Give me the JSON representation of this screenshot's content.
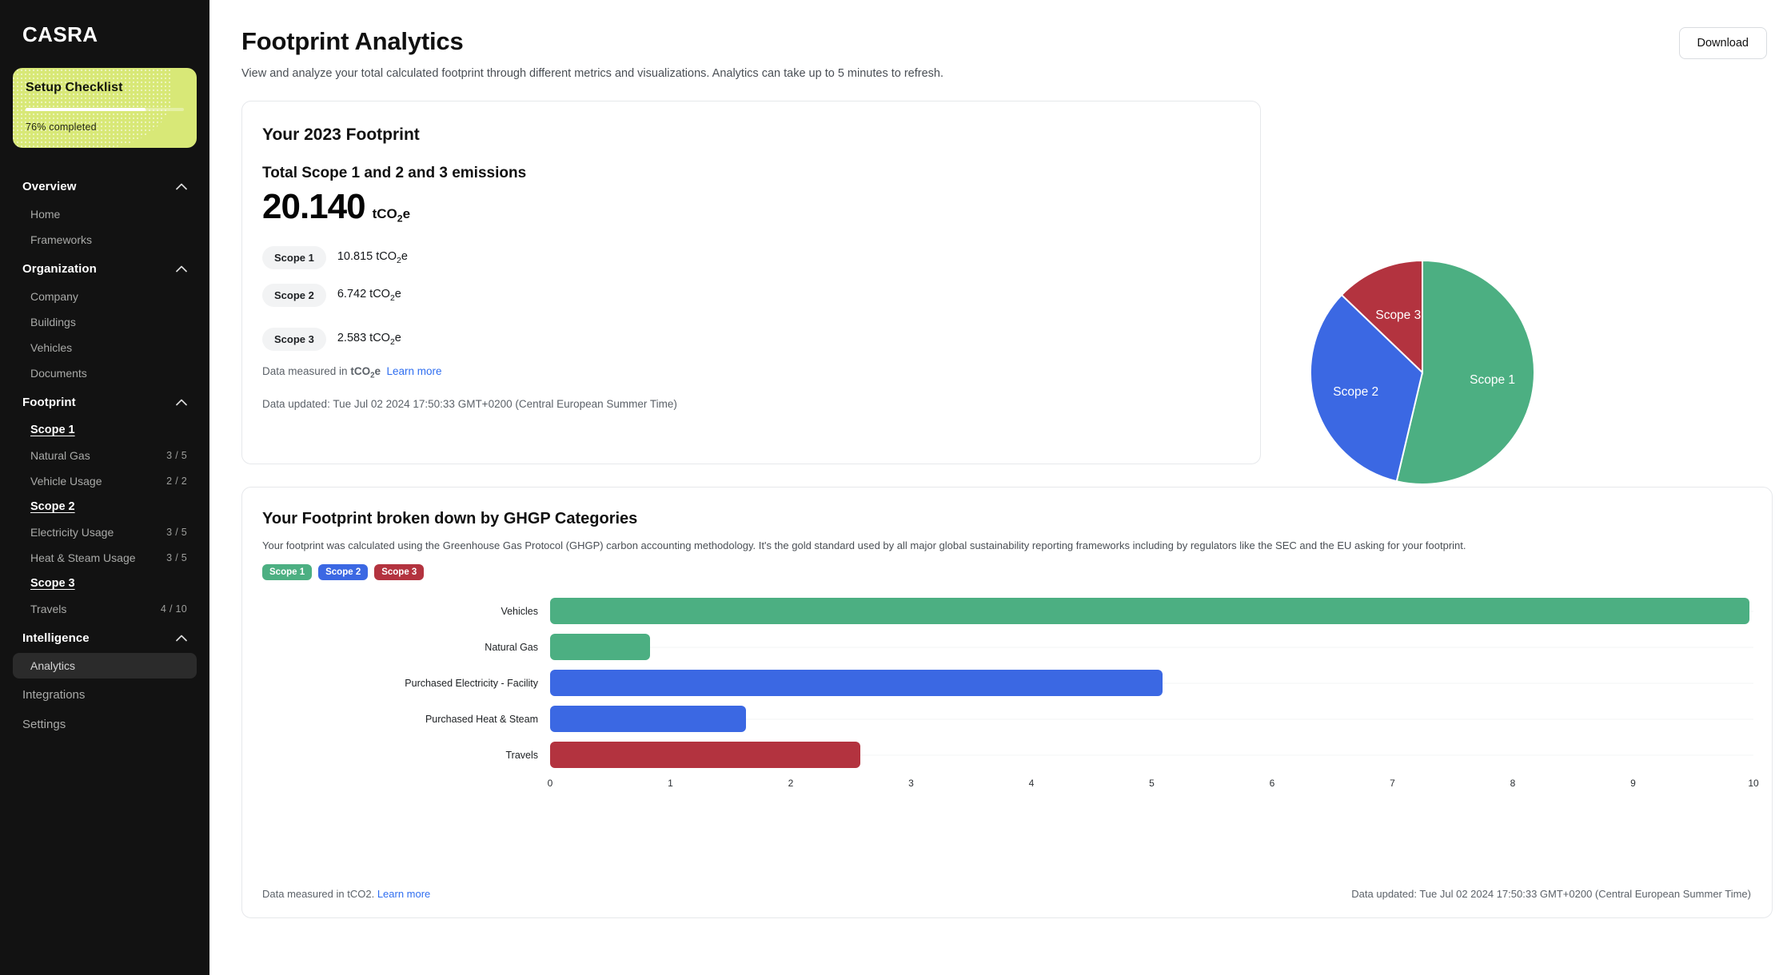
{
  "brand": "CASRA",
  "checklist": {
    "title": "Setup Checklist",
    "progress_label": "76% completed",
    "progress_percent": 76,
    "bg_color": "#d8e877"
  },
  "sidebar": {
    "groups": [
      {
        "label": "Overview",
        "expanded": true,
        "items": [
          {
            "label": "Home",
            "count": "",
            "kind": "item",
            "active": false
          },
          {
            "label": "Frameworks",
            "count": "",
            "kind": "item",
            "active": false
          }
        ]
      },
      {
        "label": "Organization",
        "expanded": true,
        "items": [
          {
            "label": "Company",
            "count": "",
            "kind": "item",
            "active": false
          },
          {
            "label": "Buildings",
            "count": "",
            "kind": "item",
            "active": false
          },
          {
            "label": "Vehicles",
            "count": "",
            "kind": "item",
            "active": false
          },
          {
            "label": "Documents",
            "count": "",
            "kind": "item",
            "active": false
          }
        ]
      },
      {
        "label": "Footprint",
        "expanded": true,
        "items": [
          {
            "label": "Scope 1",
            "count": "",
            "kind": "scope",
            "active": false
          },
          {
            "label": "Natural Gas",
            "count": "3 / 5",
            "kind": "item",
            "active": false
          },
          {
            "label": "Vehicle Usage",
            "count": "2 / 2",
            "kind": "item",
            "active": false
          },
          {
            "label": "Scope 2",
            "count": "",
            "kind": "scope",
            "active": false
          },
          {
            "label": "Electricity Usage",
            "count": "3 / 5",
            "kind": "item",
            "active": false
          },
          {
            "label": "Heat & Steam Usage",
            "count": "3 / 5",
            "kind": "item",
            "active": false
          },
          {
            "label": "Scope 3",
            "count": "",
            "kind": "scope",
            "active": false
          },
          {
            "label": "Travels",
            "count": "4 / 10",
            "kind": "item",
            "active": false
          }
        ]
      },
      {
        "label": "Intelligence",
        "expanded": true,
        "items": [
          {
            "label": "Analytics",
            "count": "",
            "kind": "item",
            "active": true
          }
        ]
      }
    ],
    "flat_items": [
      {
        "label": "Integrations"
      },
      {
        "label": "Settings"
      }
    ]
  },
  "header": {
    "title": "Footprint Analytics",
    "subtitle": "View and analyze your total calculated footprint through different metrics and visualizations. Analytics can take up to 5 minutes to refresh.",
    "download_label": "Download"
  },
  "footprint_card": {
    "title": "Your 2023 Footprint",
    "total_label": "Total Scope 1 and 2 and 3 emissions",
    "total_value": "20.140",
    "unit_prefix": "tCO",
    "unit_sub": "2",
    "unit_suffix": "e",
    "scopes": [
      {
        "pill": "Scope 1",
        "value": "10.815 tCO",
        "sub": "2",
        "value_suffix": "e"
      },
      {
        "pill": "Scope 2",
        "value": "6.742 tCO",
        "sub": "2",
        "value_suffix": "e"
      },
      {
        "pill": "Scope 3",
        "value": "2.583 tCO",
        "sub": "2",
        "value_suffix": "e"
      }
    ],
    "measured_prefix": "Data measured in",
    "measured_unit": "tCO",
    "measured_sub": "2",
    "measured_suffix": "e",
    "learn_more": "Learn more",
    "updated": "Data updated: Tue Jul 02 2024 17:50:33 GMT+0200 (Central European Summer Time)"
  },
  "breakdown_card": {
    "title": "Your Footprint broken down by GHGP Categories",
    "subtitle": "Your footprint was calculated using the Greenhouse Gas Protocol (GHGP) carbon accounting methodology. It's the gold standard used by all major global sustainability reporting frameworks including by regulators like the SEC and the EU asking for your footprint.",
    "footer_measured": "Data measured in tCO2.",
    "footer_learn_more": "Learn more",
    "footer_updated": "Data updated: Tue Jul 02 2024 17:50:33 GMT+0200 (Central European Summer Time)"
  },
  "colors": {
    "scope1": "#4caf82",
    "scope2": "#3b68e3",
    "scope3": "#b3333f",
    "accent_link": "#2f6ef0",
    "sidebar_bg": "#121212"
  },
  "chart_data": [
    {
      "type": "pie",
      "title": "",
      "labels": [
        "Scope 1",
        "Scope 2",
        "Scope 3"
      ],
      "values": [
        10.815,
        6.742,
        2.583
      ],
      "percentages": [
        53.7,
        33.5,
        12.8
      ],
      "colors": [
        "#4caf82",
        "#3b68e3",
        "#b3333f"
      ],
      "legend": "none",
      "labels_inside": true
    },
    {
      "type": "bar",
      "orientation": "horizontal",
      "title": "Your Footprint broken down by GHGP Categories",
      "categories": [
        "Vehicles",
        "Natural Gas",
        "Purchased Electricity - Facility",
        "Purchased Heat & Steam",
        "Travels"
      ],
      "values": [
        9.97,
        0.83,
        5.09,
        1.63,
        2.58
      ],
      "bar_colors": [
        "#4caf82",
        "#4caf82",
        "#3b68e3",
        "#3b68e3",
        "#b3333f"
      ],
      "series": [
        {
          "name": "Scope 1",
          "color": "#4caf82"
        },
        {
          "name": "Scope 2",
          "color": "#3b68e3"
        },
        {
          "name": "Scope 3",
          "color": "#b3333f"
        }
      ],
      "xlabel": "",
      "ylabel": "",
      "xlim": [
        0,
        10
      ],
      "xticks": [
        "0",
        "1",
        "2",
        "3",
        "4",
        "5",
        "6",
        "7",
        "8",
        "9",
        "10"
      ],
      "grid": false,
      "legend": "top-left"
    }
  ]
}
